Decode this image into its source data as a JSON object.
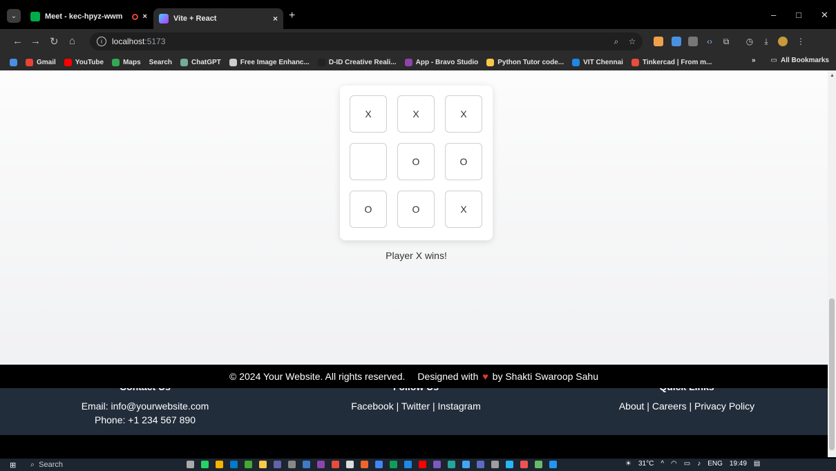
{
  "browser": {
    "tabs": [
      {
        "title": "Meet - kec-hpyz-wwm",
        "favicon_color": "#00ac47",
        "active": false
      },
      {
        "title": "Vite + React",
        "favicon_color": "#a25cfc",
        "active": true
      }
    ],
    "new_tab": "+",
    "close_tab": "×",
    "window_controls": {
      "minimize": "–",
      "maximize": "□",
      "close": "✕"
    },
    "url": {
      "host": "localhost",
      "port": ":5173"
    },
    "bookmarks": [
      {
        "label": "Gmail",
        "color": "#ea4335"
      },
      {
        "label": "YouTube",
        "color": "#ff0000"
      },
      {
        "label": "Maps",
        "color": "#34a853"
      },
      {
        "label": "Search",
        "color": "#2b2b2b"
      },
      {
        "label": "ChatGPT",
        "color": "#74aa9c"
      },
      {
        "label": "Free Image Enhanc...",
        "color": "#cccccc"
      },
      {
        "label": "D-ID Creative Reali...",
        "color": "#222222"
      },
      {
        "label": "App - Bravo Studio",
        "color": "#8e44ad"
      },
      {
        "label": "Python Tutor code...",
        "color": "#f7c948"
      },
      {
        "label": "VIT Chennai",
        "color": "#1e88e5"
      },
      {
        "label": "Tinkercad | From m...",
        "color": "#e74c3c"
      }
    ],
    "all_bookmarks": "All Bookmarks",
    "overflow": "»"
  },
  "game": {
    "board": [
      "X",
      "X",
      "X",
      "",
      "O",
      "O",
      "O",
      "O",
      "X"
    ],
    "status": "Player X wins!"
  },
  "footer": {
    "contact": {
      "heading": "Contact Us",
      "email": "Email: info@yourwebsite.com",
      "phone": "Phone: +1 234 567 890"
    },
    "follow": {
      "heading": "Follow Us",
      "links": "Facebook | Twitter | Instagram"
    },
    "quick": {
      "heading": "Quick Links",
      "links": "About | Careers | Privacy Policy"
    },
    "copyright": "© 2024 Your Website. All rights reserved.",
    "designed_prefix": "Designed with",
    "designed_suffix": "by Shakti Swaroop Sahu"
  },
  "taskbar": {
    "search": "Search",
    "weather": "31°C",
    "lang": "ENG",
    "time": "19:49"
  }
}
